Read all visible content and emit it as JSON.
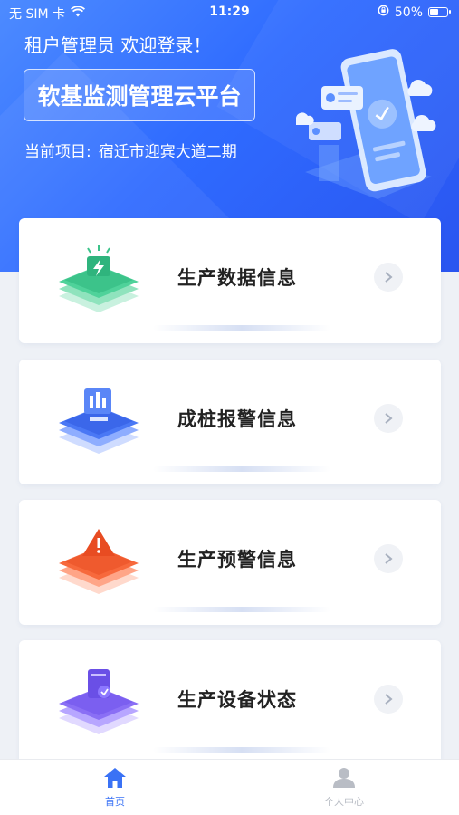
{
  "status_bar": {
    "carrier": "无 SIM 卡",
    "time": "11:29",
    "battery_percent": "50%"
  },
  "header": {
    "greeting": "租户管理员 欢迎登录！",
    "platform_title": "软基监测管理云平台",
    "project_label": "当前项目:",
    "project_name": "宿迁市迎宾大道二期"
  },
  "cards": [
    {
      "label": "生产数据信息",
      "icon": "green-lightning-platform-icon",
      "color": "#35c28a"
    },
    {
      "label": "成桩报警信息",
      "icon": "blue-chart-platform-icon",
      "color": "#3b6df2"
    },
    {
      "label": "生产预警信息",
      "icon": "orange-warning-platform-icon",
      "color": "#f0643a"
    },
    {
      "label": "生产设备状态",
      "icon": "purple-device-platform-icon",
      "color": "#7b62f0"
    }
  ],
  "tabbar": {
    "home_label": "首页",
    "me_label": "个人中心",
    "active_color": "#3a72f5",
    "inactive_color": "#b9bdc5"
  }
}
